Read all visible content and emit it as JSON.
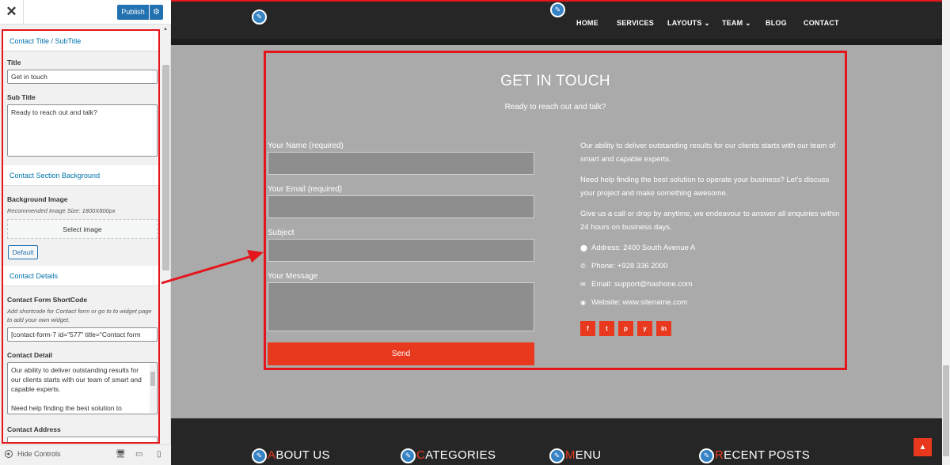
{
  "sidebar": {
    "close_label": "✕",
    "publish_label": "Publish",
    "gear_icon": "gear-icon",
    "sections": {
      "contact_title": {
        "header": "Contact Title / SubTitle",
        "title_label": "Title",
        "title_value": "Get in touch",
        "subtitle_label": "Sub Title",
        "subtitle_value": "Ready to reach out and talk?"
      },
      "background": {
        "header": "Contact Section Background",
        "image_label": "Background Image",
        "image_desc": "Recommended Image Size: 1800X800px",
        "select_image": "Select image",
        "default_button": "Default"
      },
      "details": {
        "header": "Contact Details",
        "shortcode_label": "Contact Form ShortCode",
        "shortcode_desc": "Add shortcode for Contact form or go to to widget page to add your own widget.",
        "shortcode_value": "[contact-form-7 id=\"577\" title=\"Contact form",
        "detail_label": "Contact Detail",
        "detail_value_1": "Our ability to deliver outstanding results for our clients starts with our team of smart and capable experts.",
        "detail_value_2": "Need help finding the best solution to",
        "address_label": "Contact Address"
      }
    },
    "bottom": {
      "hide_controls": "Hide Controls"
    }
  },
  "preview": {
    "nav": {
      "items": [
        "HOME",
        "SERVICES",
        "LAYOUTS",
        "TEAM",
        "BLOG",
        "CONTACT"
      ],
      "dropdown_marker": "⌄"
    },
    "contact": {
      "title": "GET IN TOUCH",
      "subtitle": "Ready to reach out and talk?",
      "form": {
        "name_label": "Your Name (required)",
        "email_label": "Your Email (required)",
        "subject_label": "Subject",
        "message_label": "Your Message",
        "send": "Send"
      },
      "paragraphs": [
        "Our ability to deliver outstanding results for our clients starts with our team of smart and capable experts.",
        "Need help finding the best solution to operate your business? Let's discuss your project and make something awesome.",
        "Give us a call or drop by anytime, we endeavour to answer all enquiries within 24 hours on business days."
      ],
      "address": "Address: 2400 South Avenue A",
      "phone": "Phone: +928 336 2000",
      "email": "Email: support@hashone.com",
      "website": "Website: www.sitename.com",
      "social": [
        "f",
        "t",
        "p",
        "y",
        "in"
      ]
    },
    "footer": {
      "headings": [
        {
          "first": "A",
          "rest": "BOUT US"
        },
        {
          "first": "C",
          "rest": "ATEGORIES"
        },
        {
          "first": "M",
          "rest": "ENU"
        },
        {
          "first": "R",
          "rest": "ECENT POSTS"
        }
      ]
    }
  },
  "colors": {
    "accent": "#e8381e",
    "highlight": "#e4161c",
    "wp_blue": "#2271b1"
  }
}
